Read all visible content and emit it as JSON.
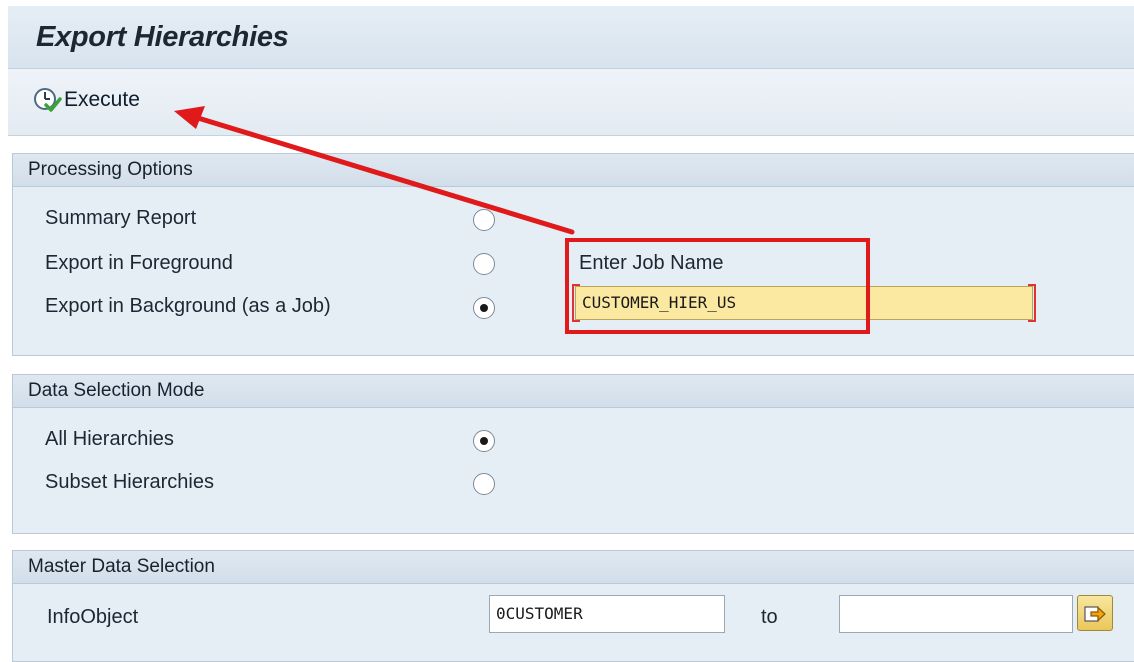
{
  "window": {
    "title": "Export Hierarchies"
  },
  "toolbar": {
    "execute_label": "Execute"
  },
  "processing_options": {
    "title": "Processing Options",
    "options": [
      {
        "label": "Summary Report",
        "selected": false
      },
      {
        "label": "Export in Foreground",
        "selected": false
      },
      {
        "label": "Export in Background (as a Job)",
        "selected": true
      }
    ],
    "job_name_label": "Enter Job Name",
    "job_name_value": "CUSTOMER_HIER_US"
  },
  "data_selection_mode": {
    "title": "Data Selection Mode",
    "options": [
      {
        "label": "All Hierarchies",
        "selected": true
      },
      {
        "label": "Subset Hierarchies",
        "selected": false
      }
    ]
  },
  "master_data_selection": {
    "title": "Master Data Selection",
    "infoobject_label": "InfoObject",
    "from_value": "0CUSTOMER",
    "to_label": "to",
    "to_value": ""
  },
  "icons": {
    "execute": "execute-clock-icon",
    "multiple_selection": "multiple-selection-arrow-icon"
  },
  "colors": {
    "annotation": "#e01a1a",
    "required_field": "#fbe9a1",
    "group_background": "#e6eef5"
  }
}
